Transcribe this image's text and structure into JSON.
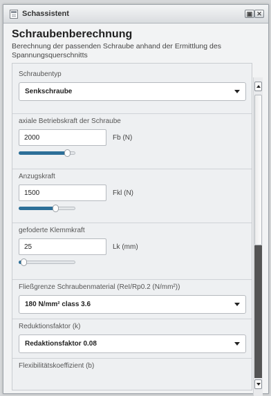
{
  "window": {
    "title": "Schassistent"
  },
  "header": {
    "title": "Schraubenberechnung",
    "subtitle": "Berechnung der passenden Schraube anhand der Ermittlung des Spannungsquerschnitts"
  },
  "fields": {
    "screw_type": {
      "label": "Schraubentyp",
      "value": "Senkschraube"
    },
    "axial_force": {
      "label": "axiale Betriebskraft der Schraube",
      "value": "2000",
      "unit": "Fb (N)",
      "slider_level": 0.85
    },
    "tightening_force": {
      "label": "Anzugskraft",
      "value": "1500",
      "unit": "Fkl (N)",
      "slider_level": 0.65
    },
    "clamping_force": {
      "label": "gefoderte Klemmkraft",
      "value": "25",
      "unit": "Lk (mm)",
      "slider_level": 0.08
    },
    "yield_strength": {
      "label": "Fließgrenze Schraubenmaterial (ReI/Rp0.2 (N/mm²))",
      "value": "180 N/mm² class 3.6"
    },
    "reduction_factor": {
      "label": "Reduktionsfaktor (k)",
      "value": "Redaktionsfaktor 0.08"
    },
    "flexibility_coefficient": {
      "label": "Flexibilitätskoeffizient (b)"
    }
  },
  "icons": {
    "app": "document-icon",
    "window_buttons": [
      "restore-icon",
      "close-icon"
    ],
    "dropdown": "chevron-down-icon"
  },
  "colors": {
    "slider_fill": "#2c6f98",
    "scrollbar_lower": "#545454"
  }
}
